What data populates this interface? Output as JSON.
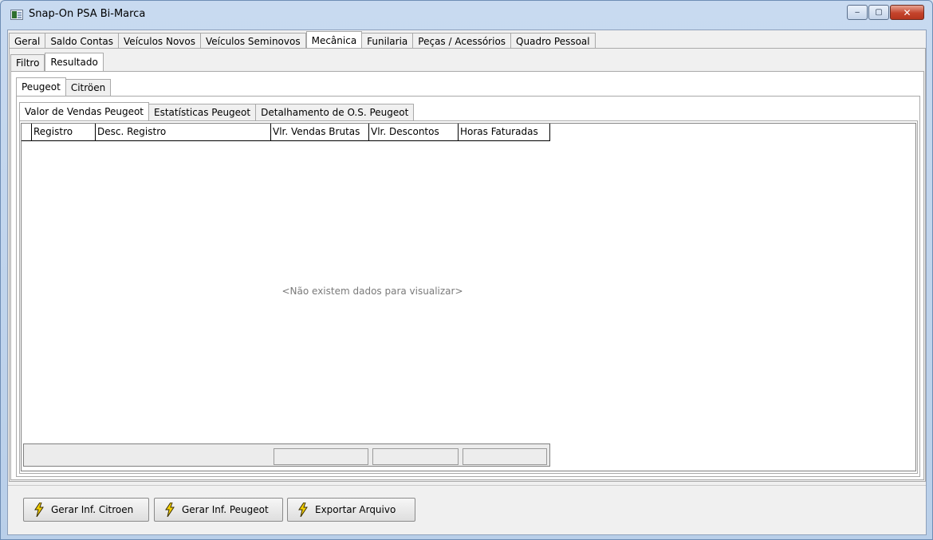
{
  "window": {
    "title": "Snap-On PSA Bi-Marca",
    "controls": {
      "minimize": "‒",
      "maximize": "▢",
      "close": "✕"
    }
  },
  "main_tabs": [
    "Geral",
    "Saldo Contas",
    "Veículos Novos",
    "Veículos Seminovos",
    "Mecânica",
    "Funilaria",
    "Peças / Acessórios",
    "Quadro Pessoal"
  ],
  "main_active": "Mecânica",
  "sub_tabs": [
    "Filtro",
    "Resultado"
  ],
  "sub_active": "Resultado",
  "brand_tabs": [
    "Peugeot",
    "Citröen"
  ],
  "brand_active": "Peugeot",
  "report_tabs": [
    "Valor de Vendas Peugeot",
    "Estatísticas Peugeot",
    "Detalhamento de O.S. Peugeot"
  ],
  "report_active": "Valor de Vendas Peugeot",
  "grid": {
    "columns": [
      "Registro",
      "Desc. Registro",
      "Vlr. Vendas Brutas",
      "Vlr. Descontos",
      "Horas Faturadas"
    ],
    "empty_message": "<Não existem dados para visualizar>"
  },
  "actions": {
    "gerar_citroen": "Gerar Inf. Citroen",
    "gerar_peugeot": "Gerar Inf. Peugeot",
    "exportar": "Exportar Arquivo"
  },
  "colors": {
    "bolt": "#f4d000",
    "bolt_stroke": "#3a2e00"
  }
}
